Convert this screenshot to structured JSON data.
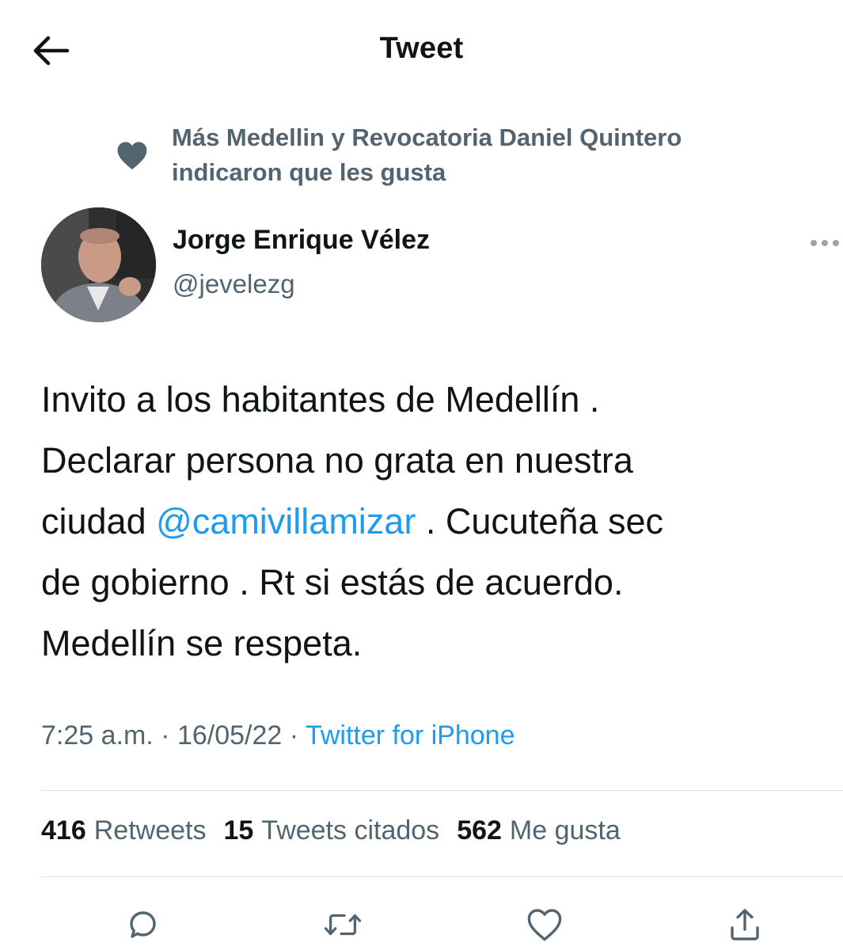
{
  "header": {
    "title": "Tweet",
    "back_icon": "arrow-left-icon"
  },
  "social_context": {
    "icon": "heart-filled-icon",
    "line1": "Más Medellin y Revocatoria Daniel Quintero",
    "line2": "indicaron que les gusta"
  },
  "author": {
    "name": "Jorge Enrique Vélez",
    "handle": "@jevelezg",
    "more_icon": "more-horizontal-icon"
  },
  "tweet": {
    "line1": "Invito a los habitantes de Medellín .",
    "line2": "Declarar persona no grata en nuestra",
    "line3_prefix": "ciudad ",
    "mention": "@camivillamizar",
    "line3_suffix": " . Cucuteña sec",
    "line4": "de gobierno . Rt si estás de acuerdo.",
    "line5": "Medellín se respeta."
  },
  "meta": {
    "time": "7:25 a.m.",
    "separator": " · ",
    "date": "16/05/22",
    "source": "Twitter for iPhone"
  },
  "stats": {
    "retweets_count": "416",
    "retweets_label": "Retweets",
    "quotes_count": "15",
    "quotes_label": "Tweets citados",
    "likes_count": "562",
    "likes_label": "Me gusta"
  },
  "actions": {
    "reply_icon": "reply-icon",
    "retweet_icon": "retweet-icon",
    "like_icon": "heart-outline-icon",
    "share_icon": "share-icon"
  },
  "colors": {
    "text": "#0f1419",
    "secondary": "#536471",
    "link": "#1d9bf0",
    "divider": "#dfe3e6"
  }
}
